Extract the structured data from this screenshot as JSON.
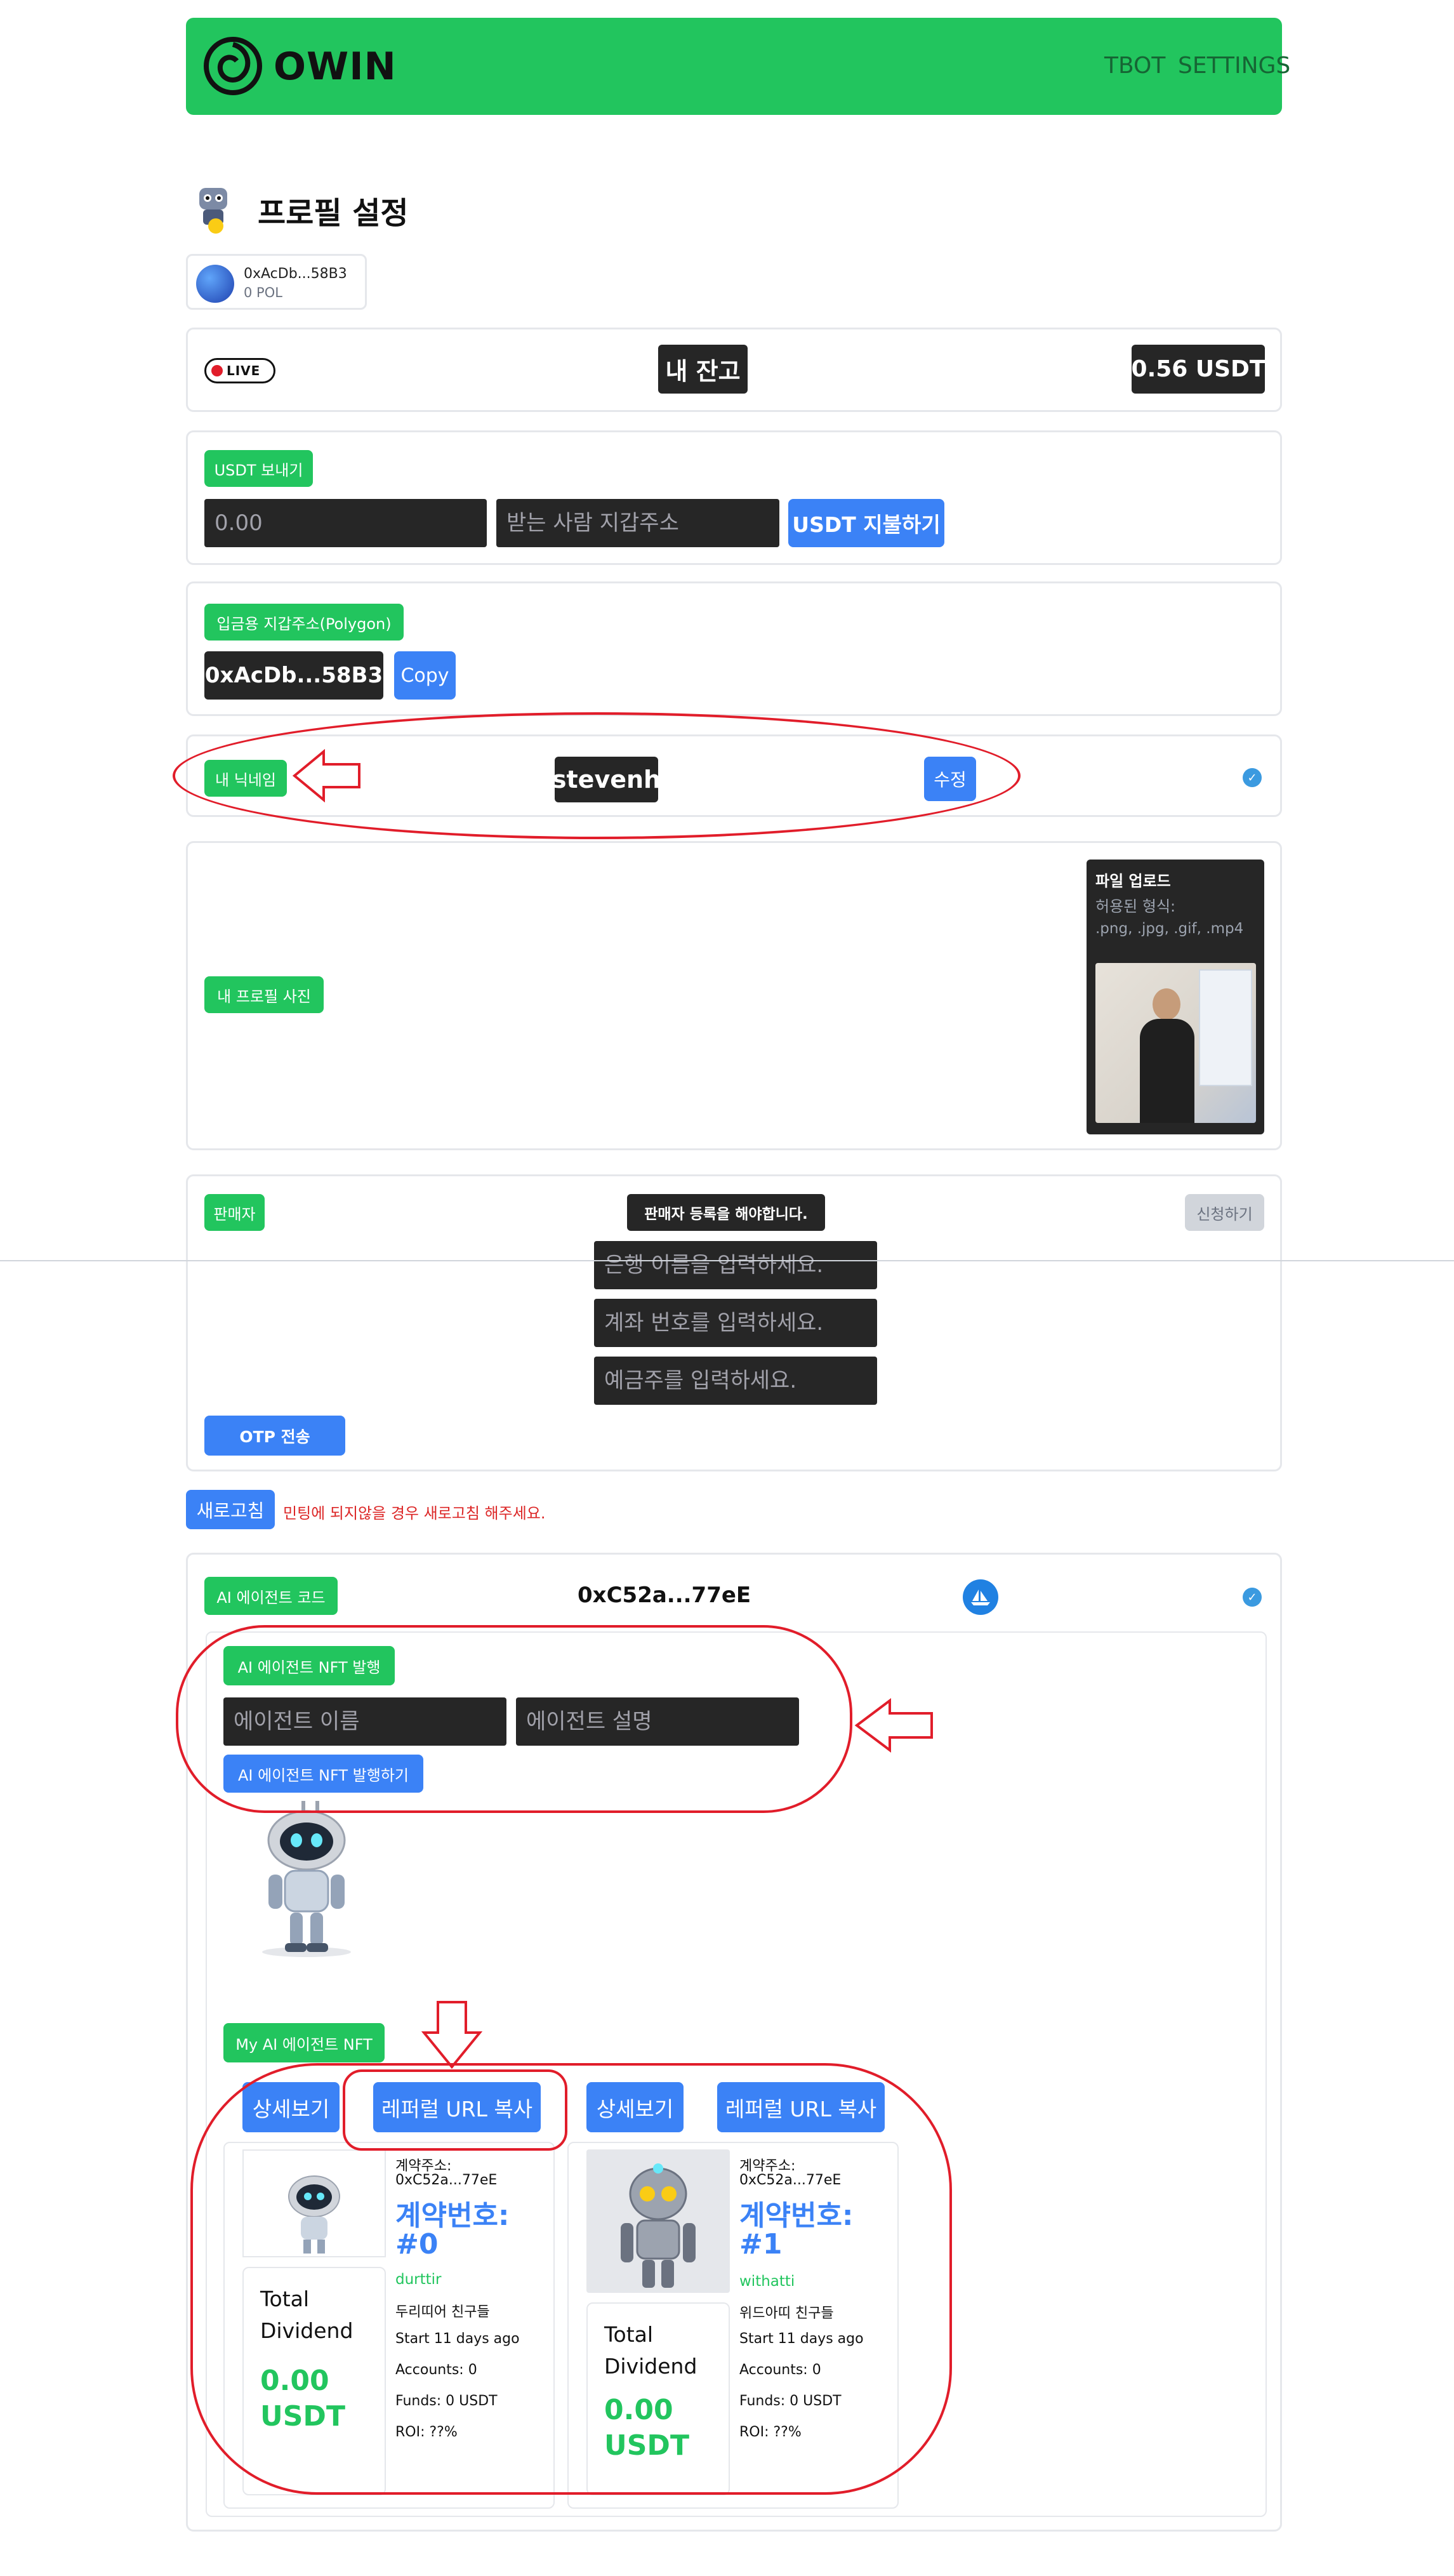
{
  "header": {
    "brand": "OWIN",
    "nav": [
      "TBOT",
      "SETTINGS"
    ],
    "colors": {
      "brand_bg": "#22c55e"
    }
  },
  "profile": {
    "title": "프로필 설정",
    "wallet_address": "0xAcDb...58B3",
    "wallet_balance": "0 POL"
  },
  "balance": {
    "live_label": "LIVE",
    "my_balance_label": "내 잔고",
    "amount": "0.56 USDT"
  },
  "send": {
    "badge": "USDT 보내기",
    "amount_placeholder": "0.00",
    "recipient_placeholder": "받는 사람 지갑주소",
    "pay_button": "USDT 지불하기"
  },
  "deposit": {
    "badge": "입금용 지갑주소(Polygon)",
    "address": "0xAcDb...58B3",
    "copy_button": "Copy"
  },
  "nickname": {
    "badge": "내 닉네임",
    "value": "stevenh",
    "edit_button": "수정"
  },
  "photo": {
    "badge": "내 프로필 사진",
    "upload_title": "파일 업로드",
    "allowed_label": "허용된 형식:",
    "allowed_formats": ".png, .jpg, .gif, .mp4"
  },
  "seller": {
    "badge": "판매자",
    "notice": "판매자 등록을 해야합니다.",
    "apply_button": "신청하기",
    "bank_placeholder": "은행 이름을 입력하세요.",
    "account_placeholder": "계좌 번호를 입력하세요.",
    "holder_placeholder": "예금주를 입력하세요.",
    "otp_button": "OTP 전송"
  },
  "refresh": {
    "button": "새로고침",
    "note": "민팅에 되지않을 경우 새로고침 해주세요."
  },
  "agent": {
    "code_badge": "AI 에이전트 코드",
    "contract": "0xC52a...77eE",
    "mint_badge": "AI 에이전트 NFT 발행",
    "name_placeholder": "에이전트 이름",
    "desc_placeholder": "에이전트 설명",
    "mint_button": "AI 에이전트 NFT 발행하기",
    "my_nft_badge": "My AI 에이전트 NFT"
  },
  "nfts": [
    {
      "detail_button": "상세보기",
      "referral_button": "레퍼럴 URL 복사",
      "contract_label": "계약주소:",
      "contract": "0xC52a...77eE",
      "number_label": "계약번호:",
      "number": "#0",
      "name": "durttir",
      "desc": "두리띠어 친구들",
      "start": "Start 11 days ago",
      "accounts": "Accounts: 0",
      "funds": "Funds: 0 USDT",
      "roi": "ROI: ??%",
      "dividend_label": "Total Dividend",
      "dividend_value": "0.00 USDT"
    },
    {
      "detail_button": "상세보기",
      "referral_button": "레퍼럴 URL 복사",
      "contract_label": "계약주소:",
      "contract": "0xC52a...77eE",
      "number_label": "계약번호:",
      "number": "#1",
      "name": "withatti",
      "desc": "위드아띠 친구들",
      "start": "Start 11 days ago",
      "accounts": "Accounts: 0",
      "funds": "Funds: 0 USDT",
      "roi": "ROI: ??%",
      "dividend_label": "Total Dividend",
      "dividend_value": "0.00 USDT"
    }
  ],
  "icons": [
    "owin-logo-icon",
    "avatar-robot-icon",
    "wallet-avatar-icon",
    "live-icon",
    "verified-icon",
    "opensea-icon",
    "arrow-annotation-icon",
    "robot-image",
    "profile-photo"
  ]
}
